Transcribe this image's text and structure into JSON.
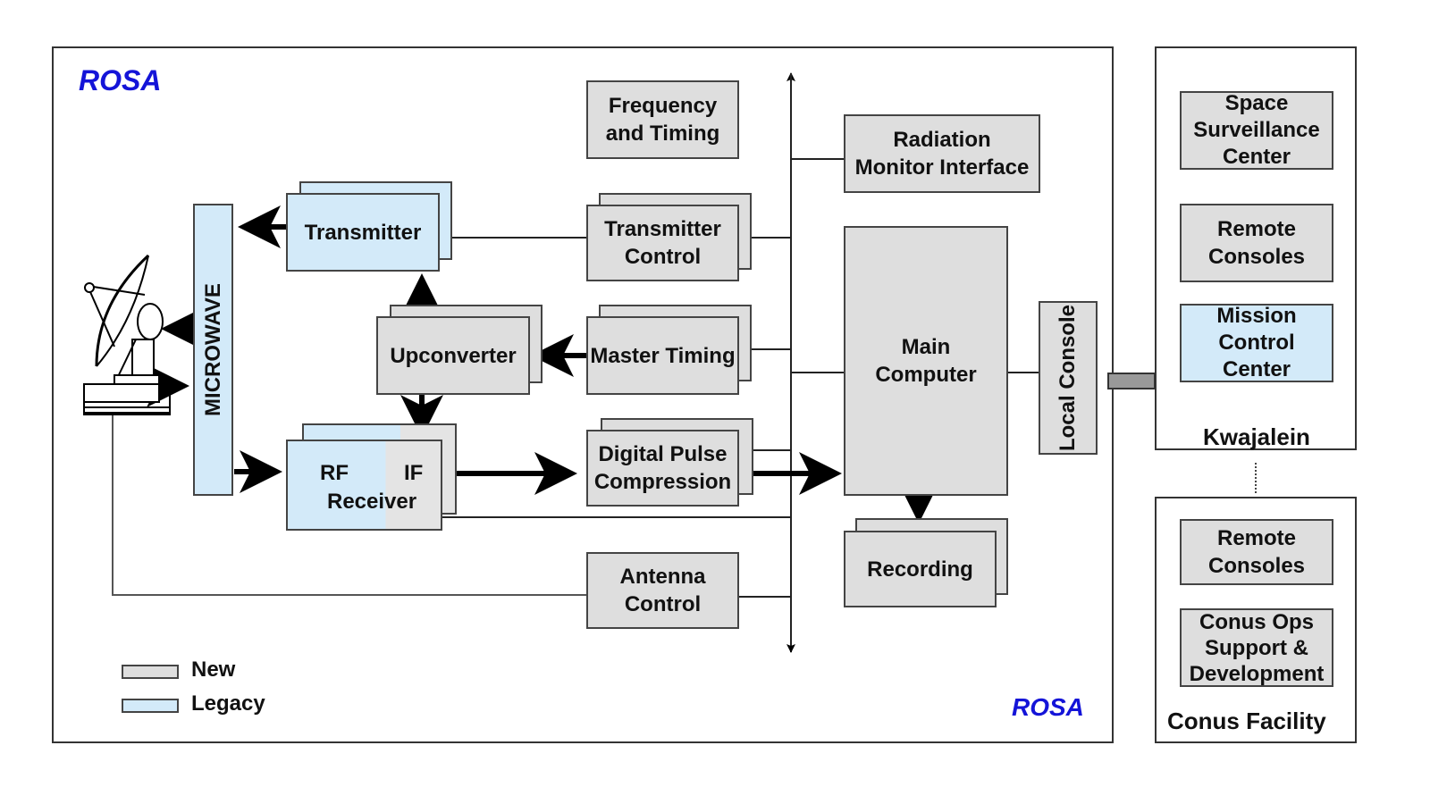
{
  "diagram_title": "ROSA",
  "site_label": "ROSA",
  "legend": [
    {
      "label": "New",
      "color": "#dedede"
    },
    {
      "label": "Legacy",
      "color": "#d3eaf9"
    }
  ],
  "rosa_blocks": {
    "frequency_timing": "Frequency\nand Timing",
    "radiation_monitor": "Radiation\nMonitor Interface",
    "transmitter": "Transmitter",
    "transmitter_control": "Transmitter\nControl",
    "microwave": "MICROWAVE",
    "upconverter": "Upconverter",
    "master_timing": "Master Timing",
    "main_computer": "Main\nComputer",
    "local_console": "Local\nConsole",
    "rf_receiver_rf": "RF",
    "rf_receiver_if": "IF",
    "rf_receiver_name": "Receiver",
    "digital_pulse_compression": "Digital Pulse\nCompression",
    "recording": "Recording",
    "antenna_control": "Antenna\nControl",
    "antenna_icon": "radar-dish-icon"
  },
  "kwajalein": {
    "title": "Kwajalein",
    "blocks": [
      "Space\nSurveillance\nCenter",
      "Remote\nConsoles",
      "Mission\nControl\nCenter"
    ]
  },
  "conus": {
    "title": "Conus Facility",
    "blocks": [
      "Remote\nConsoles",
      "Conus Ops\nSupport &\nDevelopment"
    ]
  }
}
